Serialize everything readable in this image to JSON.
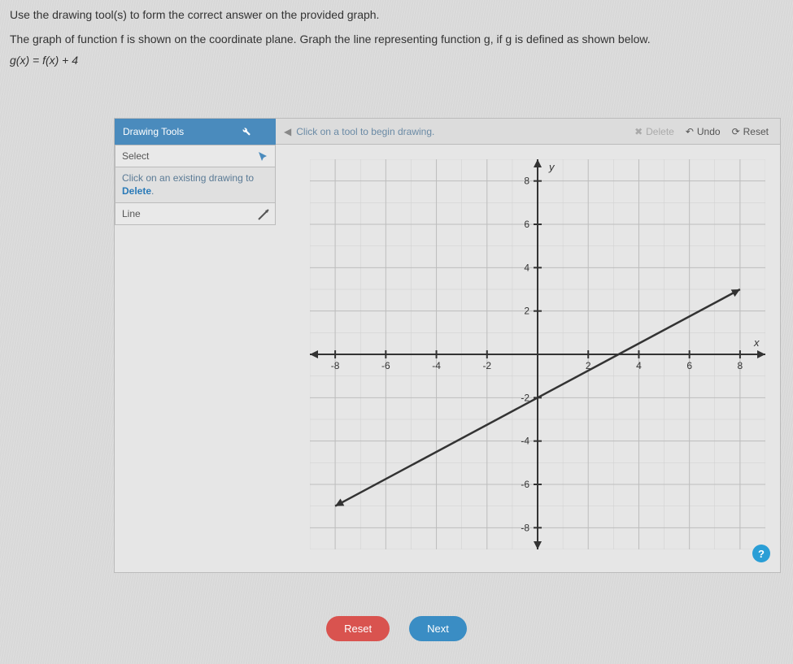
{
  "instructions": {
    "line1": "Use the drawing tool(s) to form the correct answer on the provided graph.",
    "line2": "The graph of function f is shown on the coordinate plane. Graph the line representing function g, if g is defined as shown below.",
    "equation": "g(x) = f(x) + 4"
  },
  "toolbar": {
    "header": "Drawing Tools",
    "hint": "Click on a tool to begin drawing.",
    "delete_label": "Delete",
    "undo_label": "Undo",
    "reset_label": "Reset"
  },
  "sidebar": {
    "select_label": "Select",
    "delete_note_pre": "Click on an existing drawing to ",
    "delete_note_word": "Delete",
    "delete_note_post": ".",
    "line_label": "Line"
  },
  "chart_data": {
    "type": "line",
    "title": "",
    "xlabel": "x",
    "ylabel": "y",
    "xlim": [
      -9,
      9
    ],
    "ylim": [
      -9,
      9
    ],
    "xticks": [
      -8,
      -6,
      -4,
      -2,
      2,
      4,
      6,
      8
    ],
    "yticks": [
      -8,
      -6,
      -4,
      -2,
      2,
      4,
      6,
      8
    ],
    "series": [
      {
        "name": "f",
        "x": [
          -8,
          8
        ],
        "y": [
          -7,
          3
        ]
      }
    ]
  },
  "footer": {
    "reset": "Reset",
    "next": "Next"
  },
  "help": "?"
}
